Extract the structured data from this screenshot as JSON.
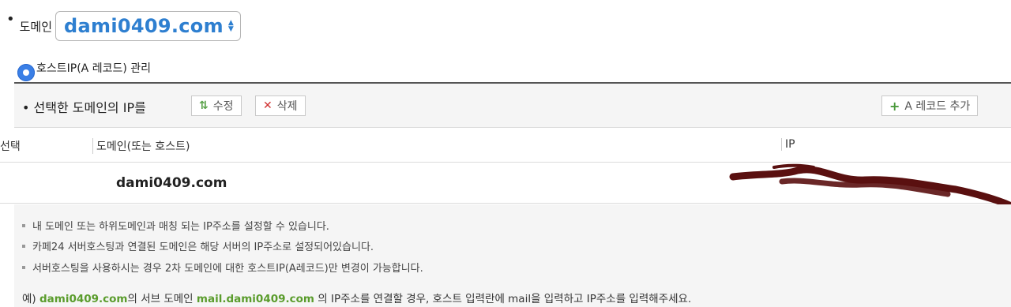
{
  "domain_selector": {
    "label": "도메인",
    "value": "dami0409.com"
  },
  "section": {
    "title": "호스트IP(A 레코드) 관리"
  },
  "toolbar": {
    "title": "• 선택한 도메인의 IP를",
    "edit_label": "수정",
    "delete_label": "삭제",
    "add_label": "A 레코드 추가"
  },
  "table": {
    "headers": [
      "선택",
      "도메인(또는 호스트)",
      "IP"
    ],
    "rows": [
      {
        "domain": "dami0409.com",
        "ip": ""
      }
    ]
  },
  "notes": [
    "내 도메인 또는 하위도메인과 매칭 되는 IP주소를 설정할 수 있습니다.",
    "카페24 서버호스팅과 연결된 도메인은 해당 서버의 IP주소로 설정되어있습니다.",
    "서버호스팅을 사용하시는 경우 2차 도메인에 대한 호스트IP(A레코드)만 변경이 가능합니다."
  ],
  "example": {
    "prefix": "예) ",
    "domain": "dami0409.com",
    "mid": "의 서브 도메인 ",
    "subdomain": "mail.dami0409.com",
    "suffix": " 의 IP주소를 연결할 경우, 호스트 입력란에 mail을 입력하고 IP주소를 입력해주세요."
  },
  "colors": {
    "accent_blue": "#2e7fd0",
    "highlight_green": "#5a9c2c",
    "delete_red": "#d03030",
    "redaction": "#5a1010"
  }
}
